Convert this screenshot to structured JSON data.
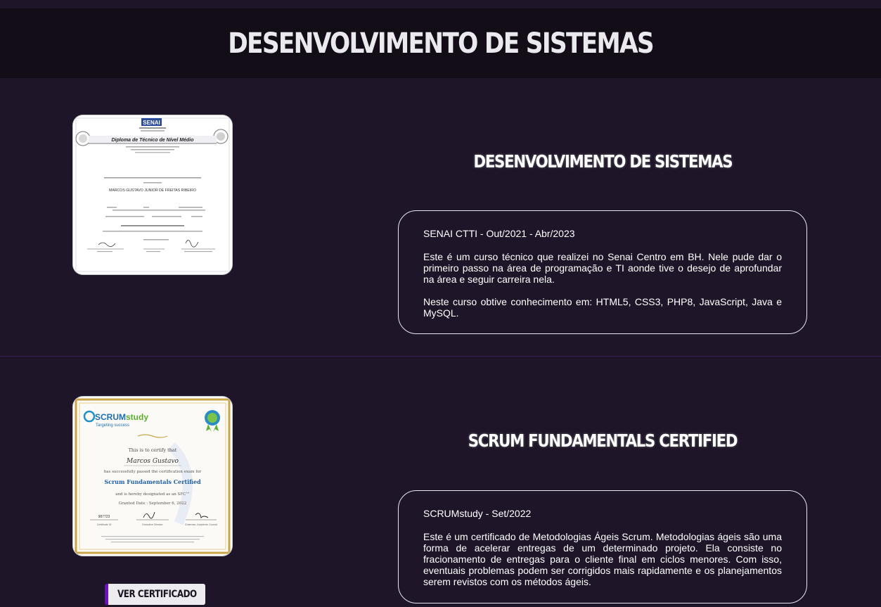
{
  "header": {
    "title": "DESENVOLVIMENTO DE SISTEMAS"
  },
  "certificates": [
    {
      "title": "DESENVOLVIMENTO DE SISTEMAS",
      "org_date": "SENAI CTTI - Out/2021 - Abr/2023",
      "paragraphs": [
        "Este é um curso técnico que realizei no Senai Centro em BH. Nele pude dar o primeiro passo na área de programação e TI aonde tive o desejo de aprofundar na área e seguir carreira nela.",
        "Neste curso obtive conhecimento em: HTML5, CSS3, PHP8, JavaScript, Java e MySQL."
      ],
      "image": {
        "logo": "SENAI",
        "heading": "Diploma de Técnico de Nível Médio",
        "name": "MARCOS GUSTAVO JUNIOR DE FREITAS RIBEIRO"
      }
    },
    {
      "title": "SCRUM FUNDAMENTALS CERTIFIED",
      "org_date": "SCRUMstudy - Set/2022",
      "paragraphs": [
        "Este é um certificado de Metodologias Ágeis Scrum. Metodologias ágeis são uma forma de acelerar entregas de um determinado projeto. Ela consiste no fracionamento de entregas para o cliente final em ciclos menores. Com isso, eventuais problemas podem ser corrigidos mais rapidamente e os planejamentos serem revistos com os métodos ágeis."
      ],
      "button_label": "VER CERTIFICADO",
      "image": {
        "logo_scrum": "SCRUM",
        "logo_study": "study",
        "tagline": "Targeting success",
        "certify_line": "This is to certify that",
        "name": "Marcos Gustavo",
        "passed_line": "has successfully passed the certification exam for",
        "course": "Scrum Fundamentals Certified",
        "designated_line": "and is hereby designated as an SFC™",
        "date_line": "Granted Date : September 6, 2022",
        "cert_id": "987723",
        "sig_labels": [
          "Certificate ID",
          "Executive Director",
          "Chairman, Academic Council"
        ]
      }
    }
  ],
  "colors": {
    "background": "#1e1628",
    "header_bg": "#120d16",
    "accent": "#6a14b8",
    "divider": "#3a1f52"
  }
}
